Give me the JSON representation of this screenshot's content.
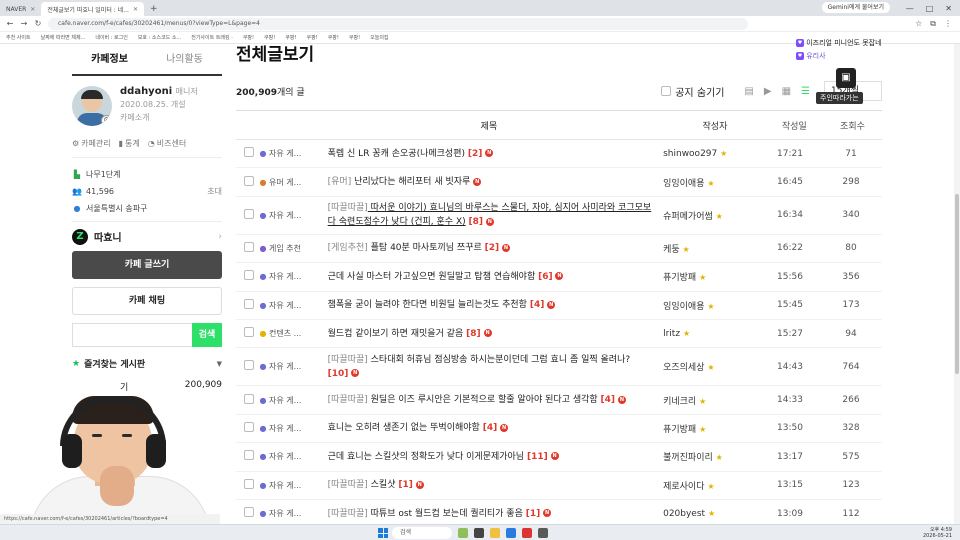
{
  "browser": {
    "tabs": [
      {
        "label": "NAVER",
        "active": false
      },
      {
        "label": "전체글보기 따효니 일미터 : 네...",
        "active": true
      }
    ],
    "gemini_label": "Gemini에게 물어보기",
    "url": "cafe.naver.com/f-e/cafes/30202461/menus/0?viewType=L&page=4",
    "bookmarks": [
      "추천 사이트",
      "날짜에 따라면 체제...",
      "네이버 : 로그인",
      "보호 : 소스코드 소...",
      "전기사이트 트래킹 ·",
      "쿠팡!",
      "쿠팡!",
      "쿠팡!",
      "쿠팡!",
      "쿠팡!",
      "쿠팡!",
      "오늘의집"
    ]
  },
  "left": {
    "tabs": [
      "카페정보",
      "나의활동"
    ],
    "profile": {
      "name": "ddahyoni",
      "role": "매니저",
      "date": "2020.08.25. 개설",
      "intro": "카페소개"
    },
    "manage": [
      "카페관리",
      "통계",
      "비즈센터"
    ],
    "stats": [
      {
        "icon": "level-icon",
        "label": "나무1단계",
        "right": ""
      },
      {
        "icon": "member-icon",
        "label": "41,596",
        "right": "초대"
      },
      {
        "icon": "location-icon",
        "label": "서울특별시 송파구",
        "right": ""
      }
    ],
    "channel": "따효니",
    "write_btn": "카페 글쓰기",
    "chat_btn": "카페 채팅",
    "search_btn": "검색",
    "fav_title": "즐겨찾는 게시판",
    "fav_item": {
      "label": "기",
      "count": "200,909"
    }
  },
  "main": {
    "title": "전체글보기",
    "count_num": "200,909",
    "count_suffix": "개의 글",
    "notice_hide": "공지 숨기기",
    "per_page": "15개씩",
    "columns": {
      "title": "제목",
      "author": "작성자",
      "date": "작성일",
      "views": "조회수"
    },
    "rows": [
      {
        "board": "자유 게...",
        "tag": "",
        "title": "폭렙 신 LR 꽁캐 손오공(나메크성편)",
        "cmt": "[2]",
        "new": true,
        "author": "shinwoo297",
        "date": "17:21",
        "views": "71",
        "tall": false
      },
      {
        "board": "유머 게...",
        "tag": "[유머]",
        "title": " 난리났다는 해리포터 새 빗자루",
        "cmt": "",
        "new": true,
        "author": "잉잉이애용",
        "date": "16:45",
        "views": "298",
        "tall": false
      },
      {
        "board": "자유 게...",
        "tag": "[따끌따끌]",
        "title": " 따서운 이야기) 효니님의 바루스는 스물더, 자야, 심지어 사미라와 코그모보다 숙련도점수가 낮다 (건피, 훈수 X)",
        "cmt": "[8]",
        "new": true,
        "author": "슈퍼메가어썸",
        "date": "16:34",
        "views": "340",
        "tall": true
      },
      {
        "board": "게임 추천",
        "tag": "[게임추천]",
        "title": " 플탐 40분 마사토끼님 쯔꾸르",
        "cmt": "[2]",
        "new": true,
        "author": "케둥",
        "date": "16:22",
        "views": "80",
        "tall": false
      },
      {
        "board": "자유 게...",
        "tag": "",
        "title": "근데 사실 마스터 가고싶으면 원딜말고 탑챔 연습해야함",
        "cmt": "[6]",
        "new": true,
        "author": "퓨기방패",
        "date": "15:56",
        "views": "356",
        "tall": false
      },
      {
        "board": "자유 게...",
        "tag": "",
        "title": "챔폭을 굳이 늘려야 한다면 비원딜 늘리는것도 추천함",
        "cmt": "[4]",
        "new": true,
        "author": "잉잉이애용",
        "date": "15:45",
        "views": "173",
        "tall": false
      },
      {
        "board": "컨텐츠 ...",
        "tag": "",
        "title": "월드컵 같이보기 하면 재밋을거 같음",
        "cmt": "[8]",
        "new": true,
        "author": "lritz",
        "date": "15:27",
        "views": "94",
        "tall": false
      },
      {
        "board": "자유 게...",
        "tag": "[따끌따끌]",
        "title": " 스타대회 허휴님 점심방송 하시는분이던데 그럼 효니 좀 일찍 올려나?",
        "cmt": "[10]",
        "new": true,
        "author": "오즈의세상",
        "date": "14:43",
        "views": "764",
        "tall": true
      },
      {
        "board": "자유 게...",
        "tag": "[따끌따끌]",
        "title": " 원딜은 이즈 루시안은 기본적으로 할줄 알아야 된다고 생각함",
        "cmt": "[4]",
        "new": true,
        "author": "키네크리",
        "date": "14:33",
        "views": "266",
        "tall": false
      },
      {
        "board": "자유 게...",
        "tag": "",
        "title": "효니는 오히려 생존기 없는 뚜벅이해야함",
        "cmt": "[4]",
        "new": true,
        "author": "퓨기방패",
        "date": "13:50",
        "views": "328",
        "tall": false
      },
      {
        "board": "자유 게...",
        "tag": "",
        "title": "근데 효니는 스킬샷의 정확도가 낮다 이게문제가아님",
        "cmt": "[11]",
        "new": true,
        "author": "불꺼진파이리",
        "date": "13:17",
        "views": "575",
        "tall": false
      },
      {
        "board": "자유 게...",
        "tag": "[따끌따끌]",
        "title": " 스킬샷",
        "cmt": "[1]",
        "new": true,
        "author": "제로사이다",
        "date": "13:15",
        "views": "123",
        "tall": false
      },
      {
        "board": "자유 게...",
        "tag": "[따끌따끌]",
        "title": " 따튜브 ost 월드컵 보는데 퀄리티가 좋음",
        "cmt": "[1]",
        "new": true,
        "author": "020byest",
        "date": "13:09",
        "views": "112",
        "tall": false
      }
    ]
  },
  "chat": {
    "messages": [
      {
        "user": "",
        "text": "이즈리얼 미니언도 못잡네"
      },
      {
        "user": "유리사",
        "text": ""
      }
    ],
    "caption": "주인따라가는"
  },
  "taskbar": {
    "search": "검색",
    "time": "오후 4:59",
    "date": "2026-05-21"
  },
  "status_url": "https://cafe.naver.com/f-e/cafes/30202461/articles/?boardtype=4"
}
